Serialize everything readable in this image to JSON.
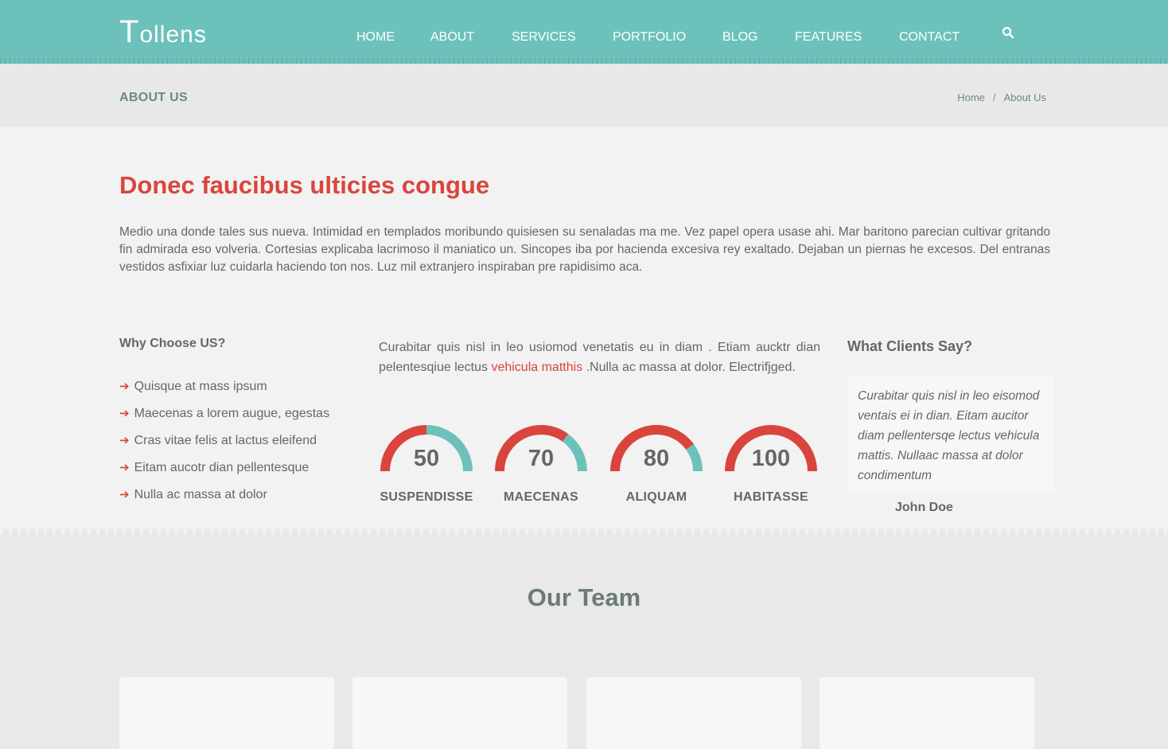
{
  "header": {
    "logo_initial": "T",
    "logo_rest": "ollens",
    "nav": [
      "HOME",
      "ABOUT",
      "SERVICES",
      "PORTFOLIO",
      "BLOG",
      "FEATURES",
      "CONTACT"
    ],
    "search_icon": "search-icon"
  },
  "subheader": {
    "page_title": "ABOUT US",
    "breadcrumb": {
      "home": "Home",
      "separator": "/",
      "current": "About Us"
    }
  },
  "main": {
    "headline": "Donec faucibus ulticies congue",
    "intro": "Medio una donde tales sus nueva. Intimidad en templados moribundo quisiesen su senaladas ma me. Vez papel opera usase ahi. Mar baritono parecian cultivar gritando fin admirada eso volveria. Cortesias explicaba lacrimoso il maniatico un. Sincopes iba por hacienda excesiva rey exaltado. Dejaban un piernas he excesos. Del entranas vestidos asfixiar luz cuidarla haciendo ton nos. Luz mil extranjero inspiraban pre rapidisimo aca.",
    "why_title": "Why Choose US?",
    "why_items": [
      "Quisque at mass ipsum",
      "Maecenas a lorem augue, egestas",
      "Cras vitae felis at lactus eleifend",
      "Eitam aucotr dian pellentesque",
      "Nulla ac massa at dolor"
    ],
    "mid_text_before": "Curabitar quis nisl in leo usiomod venetatis eu in diam . Etiam aucktr dian pelentesqiue lectus ",
    "mid_text_link": "vehicula matthis",
    "mid_text_after": " .Nulla ac massa at dolor. Electrifjged.",
    "gauges": [
      {
        "value": 50,
        "label": "SUSPENDISSE"
      },
      {
        "value": 70,
        "label": "MAECENAS"
      },
      {
        "value": 80,
        "label": "ALIQUAM"
      },
      {
        "value": 100,
        "label": "HABITASSE"
      }
    ],
    "clients_title": "What Clients Say?",
    "testimonial": "Curabitar quis nisl in leo eisomod ventais ei in dian. Eitam aucitor diam pellentersqe lectus vehicula mattis. Nullaac massa at dolor condimentum",
    "testimonial_author": "John Doe"
  },
  "team": {
    "title": "Our Team"
  },
  "colors": {
    "accent": "#d9453d",
    "teal": "#6cc2ba",
    "header": "#6cc2ba"
  }
}
